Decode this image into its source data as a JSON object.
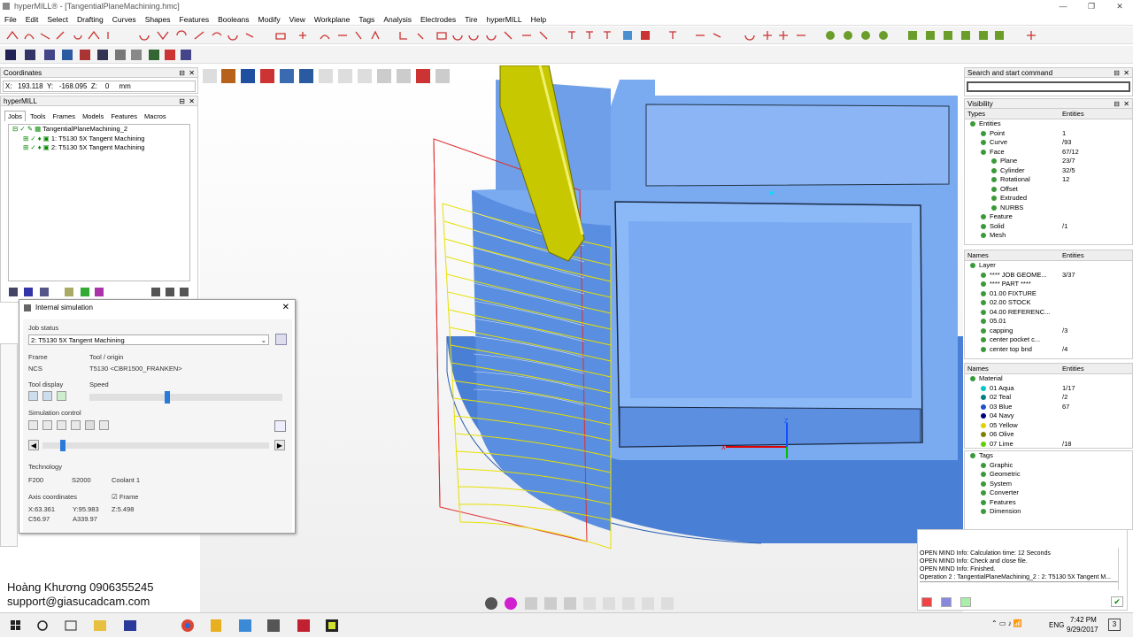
{
  "window": {
    "title": "hyperMILL® - [TangentialPlaneMachining.hmc]"
  },
  "menu": [
    "File",
    "Edit",
    "Select",
    "Drafting",
    "Curves",
    "Shapes",
    "Features",
    "Booleans",
    "Modify",
    "View",
    "Workplane",
    "Tags",
    "Analysis",
    "Electrodes",
    "Tire",
    "hyperMILL",
    "Help"
  ],
  "coords": {
    "title": "Coordinates",
    "x_label": "X:",
    "x": "193.118",
    "y_label": "Y:",
    "y": "-168.095",
    "z_label": "Z:",
    "z": "0",
    "unit": "mm"
  },
  "hypermill": {
    "title": "hyperMILL",
    "tabs": [
      "Jobs",
      "Tools",
      "Frames",
      "Models",
      "Features",
      "Macros"
    ],
    "tree": [
      "TangentialPlaneMachining_2",
      "1: T5130 5X Tangent Machining",
      "2: T5130 5X Tangent Machining"
    ]
  },
  "sim": {
    "title": "Internal simulation",
    "job_status_label": "Job status",
    "job_status": "2: T5130 5X Tangent Machining",
    "frame_label": "Frame",
    "frame": "NCS",
    "tool_label": "Tool / origin",
    "tool": "T5130  <CBR1500_FRANKEN>",
    "tool_display_label": "Tool display",
    "speed_label": "Speed",
    "speed_fraction": 0.4,
    "sim_control_label": "Simulation control",
    "progress_fraction": 0.08,
    "technology_label": "Technology",
    "f": "F200",
    "s": "S2000",
    "coolant": "Coolant 1",
    "axis_label": "Axis coordinates",
    "frame_cb": "Frame",
    "x": "X:63.361",
    "y": "Y:95.983",
    "z": "Z:5.498",
    "c": "C56.97",
    "a": "A339.97"
  },
  "overlay": {
    "name": "Hoàng Khương 0906355245",
    "email": "support@giasucadcam.com"
  },
  "search": {
    "title": "Search and start command"
  },
  "visibility": {
    "title": "Visibility",
    "col1": "Types",
    "col2": "Entities",
    "rows": [
      {
        "n": "Entities",
        "v": ""
      },
      {
        "n": "Point",
        "v": "1"
      },
      {
        "n": "Curve",
        "v": "/93"
      },
      {
        "n": "Face",
        "v": "67/12"
      },
      {
        "n": "Plane",
        "v": "23/7"
      },
      {
        "n": "Cylinder",
        "v": "32/5"
      },
      {
        "n": "Rotational",
        "v": "12"
      },
      {
        "n": "Offset",
        "v": ""
      },
      {
        "n": "Extruded",
        "v": ""
      },
      {
        "n": "NURBS",
        "v": ""
      },
      {
        "n": "Feature",
        "v": ""
      },
      {
        "n": "Solid",
        "v": "/1"
      },
      {
        "n": "Mesh",
        "v": ""
      }
    ]
  },
  "layers": {
    "col1": "Names",
    "col2": "Entities",
    "rows": [
      {
        "n": "Layer",
        "v": ""
      },
      {
        "n": "**** JOB GEOME...",
        "v": "3/37"
      },
      {
        "n": "**** PART ****",
        "v": ""
      },
      {
        "n": "01.00 FIXTURE",
        "v": ""
      },
      {
        "n": "02.00 STOCK",
        "v": ""
      },
      {
        "n": "04.00 REFERENC...",
        "v": ""
      },
      {
        "n": "05.01",
        "v": ""
      },
      {
        "n": "capping",
        "v": "/3"
      },
      {
        "n": "center pocket c...",
        "v": ""
      },
      {
        "n": "center top bnd",
        "v": "/4"
      }
    ]
  },
  "materials": {
    "col1": "Names",
    "col2": "Entities",
    "rows": [
      {
        "n": "Material",
        "v": "",
        "c": ""
      },
      {
        "n": "01 Aqua",
        "v": "1/17",
        "c": "#00c8c8"
      },
      {
        "n": "02 Teal",
        "v": "/2",
        "c": "#008080"
      },
      {
        "n": "03 Blue",
        "v": "67",
        "c": "#1e50d0"
      },
      {
        "n": "04 Navy",
        "v": "",
        "c": "#000080"
      },
      {
        "n": "05 Yellow",
        "v": "",
        "c": "#e0d000"
      },
      {
        "n": "06 Olive",
        "v": "",
        "c": "#808000"
      },
      {
        "n": "07 Lime",
        "v": "/18",
        "c": "#60d000"
      }
    ]
  },
  "tags": {
    "rows": [
      "Tags",
      "Graphic",
      "Geometric",
      "System",
      "Converter",
      "Features",
      "Dimension"
    ]
  },
  "log": {
    "lines": [
      "OPEN MIND Info:     Calculation time: 12 Seconds",
      "OPEN MIND Info:     Check and close file.",
      "OPEN MIND Info:     Finished.",
      "Operation 2 : TangentialPlaneMachining_2 :  2: T5130 5X Tangent M..."
    ]
  },
  "tray": {
    "lang": "ENG",
    "time": "7:42 PM",
    "date": "9/29/2017",
    "notif": "3"
  },
  "colors": {
    "part": "#6a9fee",
    "tool": "#c8c800",
    "path": "#e8e000",
    "frame": "#e00000"
  }
}
